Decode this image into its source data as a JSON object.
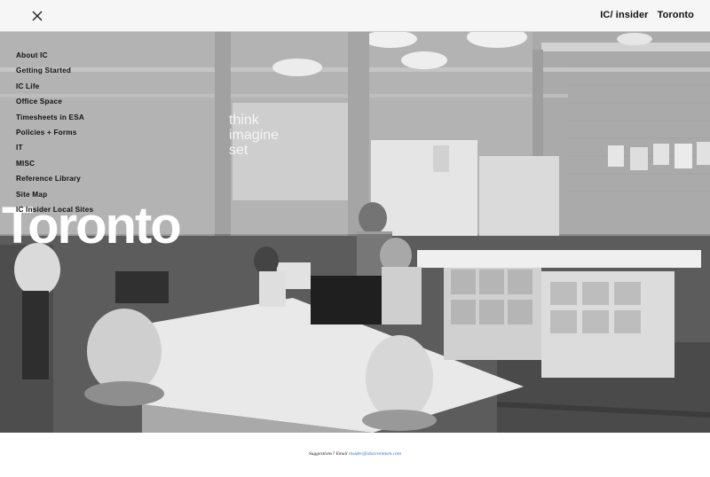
{
  "header": {
    "close_icon": "close-icon",
    "brand": "IC/ insider",
    "location": "Toronto"
  },
  "nav": {
    "items": [
      "About IC",
      "Getting Started",
      "IC Life",
      "Office Space",
      "Timesheets in ESA",
      "Policies + Forms",
      "IT",
      "MISC",
      "Reference Library",
      "Site Map",
      "IC Insider Local Sites"
    ]
  },
  "hero": {
    "title": "Toronto",
    "wall_text": [
      "think",
      "imagine",
      "set"
    ]
  },
  "footer": {
    "prefix": "Suggestions? Email",
    "email": "insider@idsceventeen.com"
  }
}
